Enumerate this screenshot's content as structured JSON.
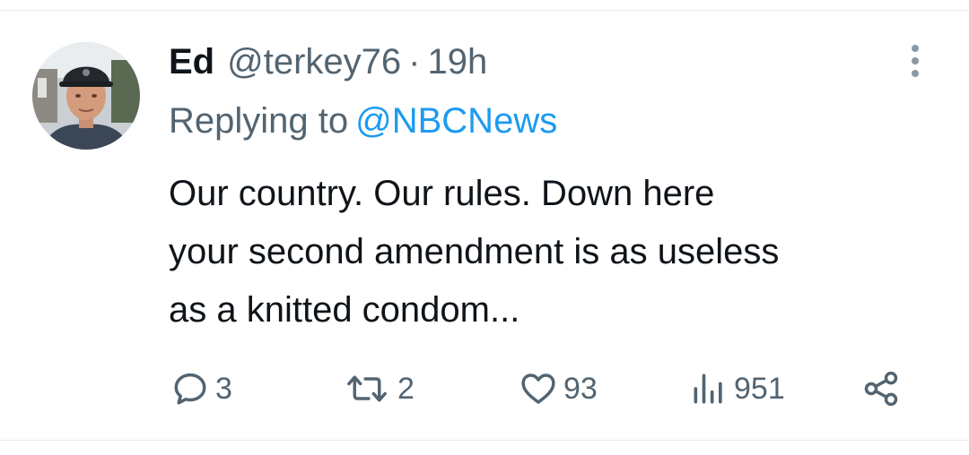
{
  "tweet": {
    "author_name": "Ed",
    "handle": "@terkey76",
    "separator": "·",
    "time": "19h",
    "replying_to_label": "Replying to",
    "replying_to_handle": "@NBCNews",
    "text": "Our country.  Our rules.  Down here\nyour second amendment is as useless\nas a knitted condom..."
  },
  "actions": {
    "reply": {
      "icon": "reply-icon",
      "count": "3"
    },
    "retweet": {
      "icon": "retweet-icon",
      "count": "2"
    },
    "like": {
      "icon": "heart-icon",
      "count": "93"
    },
    "views": {
      "icon": "views-icon",
      "count": "951"
    },
    "share": {
      "icon": "share-icon"
    }
  },
  "menu": {
    "icon": "more-options-icon"
  },
  "colors": {
    "text_primary": "#0f1419",
    "text_secondary": "#536471",
    "link": "#1d9bf0",
    "divider": "#e6ecf0"
  }
}
